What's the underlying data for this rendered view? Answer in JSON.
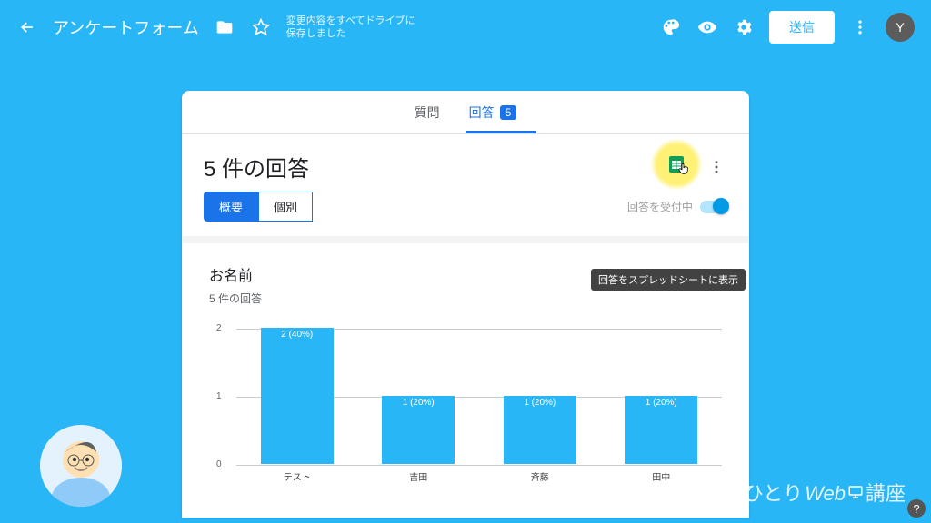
{
  "header": {
    "title": "アンケートフォーム",
    "save_msg_l1": "変更内容をすべてドライブに",
    "save_msg_l2": "保存しました",
    "send": "送信",
    "avatar_letter": "Y"
  },
  "tabs": {
    "questions": "質問",
    "responses": "回答",
    "count": "5"
  },
  "responses": {
    "title": "5 件の回答",
    "tooltip": "回答をスプレッドシートに表示",
    "seg_summary": "概要",
    "seg_individual": "個別",
    "accepting": "回答を受付中"
  },
  "question": {
    "title": "お名前",
    "sub": "5 件の回答"
  },
  "chart_data": {
    "type": "bar",
    "title": "お名前",
    "ylabel": "",
    "xlabel": "",
    "ylim": [
      0,
      2
    ],
    "yticks": [
      0,
      1,
      2
    ],
    "categories": [
      "テスト",
      "吉田",
      "斉藤",
      "田中"
    ],
    "values": [
      2,
      1,
      1,
      1
    ],
    "value_labels": [
      "2 (40%)",
      "1 (20%)",
      "1 (20%)",
      "1 (20%)"
    ]
  },
  "watermark": {
    "jp1": "ひとり",
    "web": "Web",
    "jp2": "講座"
  }
}
